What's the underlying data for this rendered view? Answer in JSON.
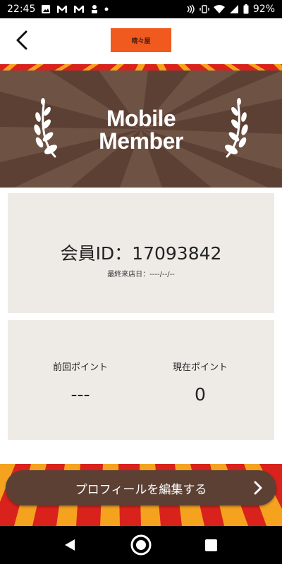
{
  "status_bar": {
    "time": "22:45",
    "battery": "92%",
    "icons": [
      "image-icon",
      "gmail-icon",
      "gmail-icon",
      "app-icon",
      "dot-icon",
      "nfc-icon",
      "vibrate-icon",
      "wifi-icon",
      "signal-icon",
      "battery-icon"
    ]
  },
  "header": {
    "back_icon": "chevron-left-icon",
    "logo_text": "晴々屋"
  },
  "banner": {
    "title_line1": "Mobile",
    "title_line2": "Member"
  },
  "member": {
    "id_text": "会員ID：17093842",
    "last_visit": "最終来店日：----/--/--"
  },
  "points": {
    "previous_label": "前回ポイント",
    "previous_value": "---",
    "current_label": "現在ポイント",
    "current_value": "0"
  },
  "edit_profile": {
    "label": "プロフィールを編集する"
  },
  "colors": {
    "brown": "#5c4034",
    "card_bg": "#eeebe7",
    "stripe_red": "#d9221c",
    "stripe_orange": "#f5a31f",
    "logo_orange": "#f05a1e"
  }
}
